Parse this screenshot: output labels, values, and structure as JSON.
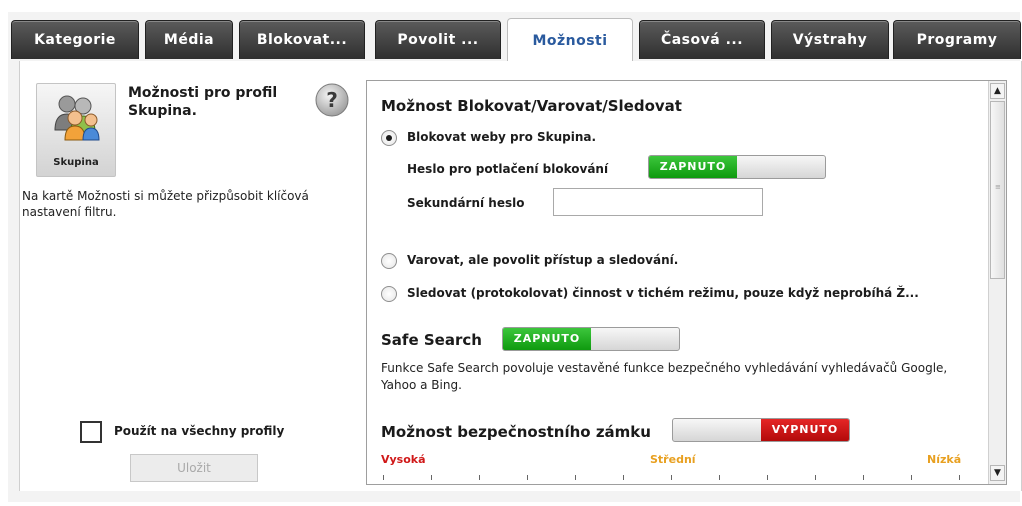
{
  "tabs": [
    {
      "label": "Kategorie"
    },
    {
      "label": "Média"
    },
    {
      "label": "Blokovat..."
    },
    {
      "label": "Povolit ..."
    },
    {
      "label": "Možnosti"
    },
    {
      "label": "Časová ..."
    },
    {
      "label": "Výstrahy"
    },
    {
      "label": "Programy"
    }
  ],
  "active_tab": "Možnosti",
  "profile": {
    "tile_label": "Skupina",
    "title": "Možnosti pro profil Skupina.",
    "description": "Na kartě Možnosti si můžete přizpůsobit klíčová nastavení filtru."
  },
  "apply_all_label": "Použít na všechny profily",
  "save_label": "Uložit",
  "main": {
    "section_title": "Možnost Blokovat/Varovat/Sledovat",
    "radio_block_label": "Blokovat weby pro Skupina.",
    "override_password_label": "Heslo pro potlačení blokování",
    "override_password_state": "ZAPNUTO",
    "secondary_password_label": "Sekundární heslo",
    "secondary_password_value": "",
    "radio_warn_label": "Varovat, ale povolit přístup a sledování.",
    "radio_monitor_label": "Sledovat (protokolovat) činnost v tichém režimu, pouze když neprobíhá Ž...",
    "safe_search_label": "Safe Search",
    "safe_search_state": "ZAPNUTO",
    "safe_search_desc": "Funkce Safe Search povoluje vestavěné funkce bezpečného vyhledávání vyhledávačů Google, Yahoo a Bing.",
    "lock_label": "Možnost bezpečnostního zámku",
    "lock_state": "VYPNUTO",
    "level_high": "Vysoká",
    "level_mid": "Střední",
    "level_low": "Nízká"
  },
  "colors": {
    "on_green": "#18a818",
    "off_red": "#c81414",
    "level_high": "#d01818",
    "level_mid": "#e8a020",
    "level_low": "#e8a020",
    "active_tab_text": "#2a5a9e"
  }
}
